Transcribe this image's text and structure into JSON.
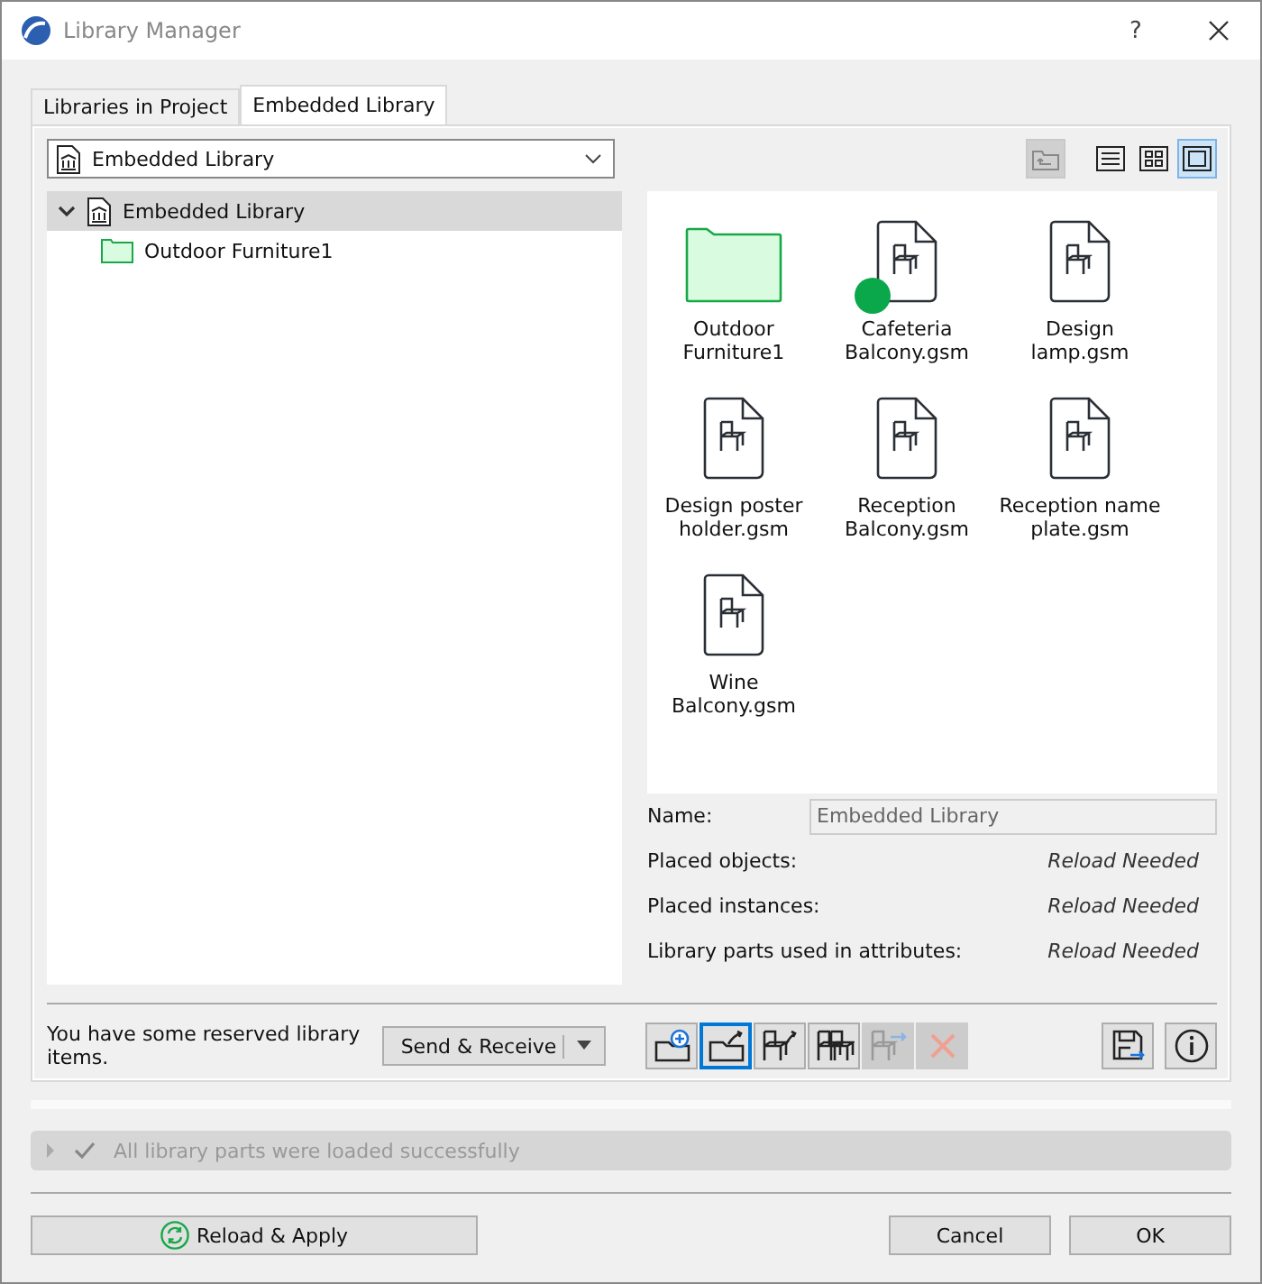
{
  "window": {
    "title": "Library Manager",
    "help": "?"
  },
  "tabs": [
    {
      "label": "Libraries in Project",
      "selected": false
    },
    {
      "label": "Embedded Library",
      "selected": true
    }
  ],
  "library_dropdown": {
    "value": "Embedded Library"
  },
  "view_buttons": [
    {
      "kind": "list",
      "selected": false
    },
    {
      "kind": "thumbs",
      "selected": false
    },
    {
      "kind": "preview",
      "selected": true
    }
  ],
  "tree": [
    {
      "label": "Embedded Library",
      "kind": "library",
      "expanded": true,
      "selected": true,
      "children": [
        {
          "label": "Outdoor Furniture1",
          "kind": "folder",
          "selected": false
        }
      ]
    }
  ],
  "items": [
    {
      "label": "Outdoor Furniture1",
      "kind": "folder",
      "reserved": false
    },
    {
      "label": "Cafeteria Balcony.gsm",
      "kind": "object",
      "reserved": true
    },
    {
      "label": "Design lamp.gsm",
      "kind": "object",
      "reserved": false
    },
    {
      "label": "Design poster holder.gsm",
      "kind": "object",
      "reserved": false
    },
    {
      "label": "Reception Balcony.gsm",
      "kind": "object",
      "reserved": false
    },
    {
      "label": "Reception name plate.gsm",
      "kind": "object",
      "reserved": false
    },
    {
      "label": "Wine Balcony.gsm",
      "kind": "object",
      "reserved": false
    }
  ],
  "name_field": {
    "label": "Name:",
    "value": "Embedded Library",
    "disabled": true
  },
  "info_rows": [
    {
      "label": "Placed objects:",
      "value": "Reload Needed"
    },
    {
      "label": "Placed instances:",
      "value": "Reload Needed"
    },
    {
      "label": "Library parts used in attributes:",
      "value": "Reload Needed"
    }
  ],
  "reserved_message": "You have some reserved library items.",
  "send_receive_button": {
    "label": "Send & Receive"
  },
  "toolbar": [
    {
      "kind": "add-folder",
      "disabled": false,
      "selected": false
    },
    {
      "kind": "export-folder",
      "disabled": false,
      "selected": true
    },
    {
      "kind": "export-object",
      "disabled": false,
      "selected": false
    },
    {
      "kind": "objects",
      "disabled": false,
      "selected": false
    },
    {
      "kind": "move-object",
      "disabled": true,
      "selected": false
    },
    {
      "kind": "delete",
      "disabled": true,
      "selected": false
    }
  ],
  "status_bar": {
    "message": "All library parts were loaded successfully",
    "expanded": false
  },
  "buttons": [
    {
      "label": "Reload & Apply",
      "kind": "reload"
    },
    {
      "label": "Cancel",
      "kind": "plain"
    },
    {
      "label": "OK",
      "kind": "plain"
    }
  ]
}
